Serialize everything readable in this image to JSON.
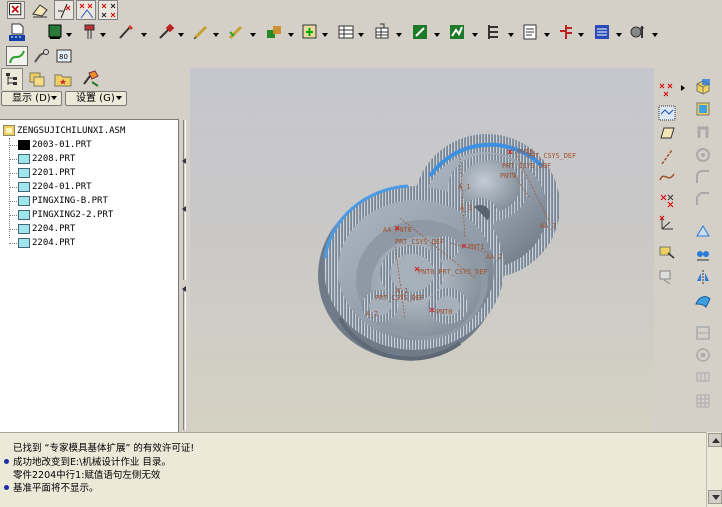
{
  "navigator": {
    "display_button": "显示 (D)",
    "settings_button": "设置 (G)"
  },
  "model_tree": {
    "root": "ZENGSUJICHILUNXI.ASM",
    "items": [
      "2003-01.PRT",
      "2208.PRT",
      "2201.PRT",
      "2204-01.PRT",
      "PINGXING-B.PRT",
      "PINGXING2-2.PRT",
      "2204.PRT",
      "2204.PRT"
    ]
  },
  "viewport_labels": {
    "pnt0_top": "PNT0",
    "prt_csys_def_top": "PRT_CSYS_DEF",
    "prt_csys_def_2": "PRT_CSYS_DEF",
    "pnt0_2": "PNT0",
    "a_1": "A_1",
    "a_3": "A_3",
    "aa_3": "AA_3",
    "aa_pnt0": "AA_PNT0",
    "prt_csys_def_3": "PRT_CSYS_DEF",
    "pnt1": "PNT1",
    "aa_2": "AA_2",
    "pnt0_prt_csys": "PNT0 PRT_CSYS_DEF",
    "a_1b": "A_1",
    "prt_csys_def_5": "PRT_CSYS_DEF",
    "pnt0_3": "PNT0",
    "a_2": "A_2"
  },
  "messages": [
    {
      "bullet": false,
      "text": "已找到 “专家模具基体扩展” 的有效许可证!"
    },
    {
      "bullet": true,
      "text": "成功地改变到E:\\机械设计作业 目录。"
    },
    {
      "bullet": false,
      "text": "零件2204中行1:赋值语句左侧无效"
    },
    {
      "bullet": true,
      "text": "基准平面将不显示。"
    }
  ],
  "colors": {
    "chrome": "#d4d0c8",
    "viewport_top": "#c6c6ce",
    "viewport_bottom": "#d5d2c3",
    "gear_body": "#8f9ba8",
    "gear_highlight": "#3d8fe0",
    "datum_label": "#a0522d",
    "message_bullet": "#1a2ea8"
  }
}
